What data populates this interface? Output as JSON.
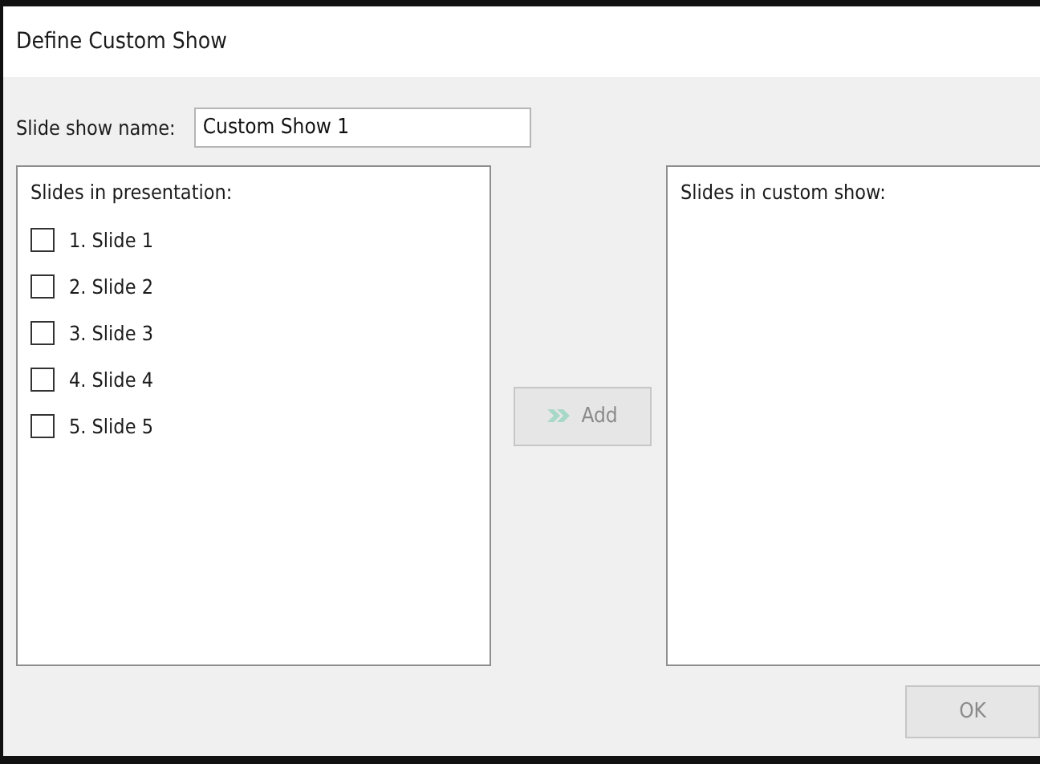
{
  "window": {
    "title": "Define Custom Show"
  },
  "name_field": {
    "label": "Slide show name:",
    "value": "Custom Show 1"
  },
  "presentation_list": {
    "label": "Slides in presentation:",
    "items": [
      {
        "label": "1. Slide 1",
        "checked": false
      },
      {
        "label": "2. Slide 2",
        "checked": false
      },
      {
        "label": "3. Slide 3",
        "checked": false
      },
      {
        "label": "4. Slide 4",
        "checked": false
      },
      {
        "label": "5. Slide 5",
        "checked": false
      }
    ]
  },
  "add_button": {
    "label": "Add",
    "disabled": true
  },
  "custom_show_list": {
    "label": "Slides in custom show:"
  },
  "ok_button": {
    "label": "OK",
    "disabled": true
  }
}
